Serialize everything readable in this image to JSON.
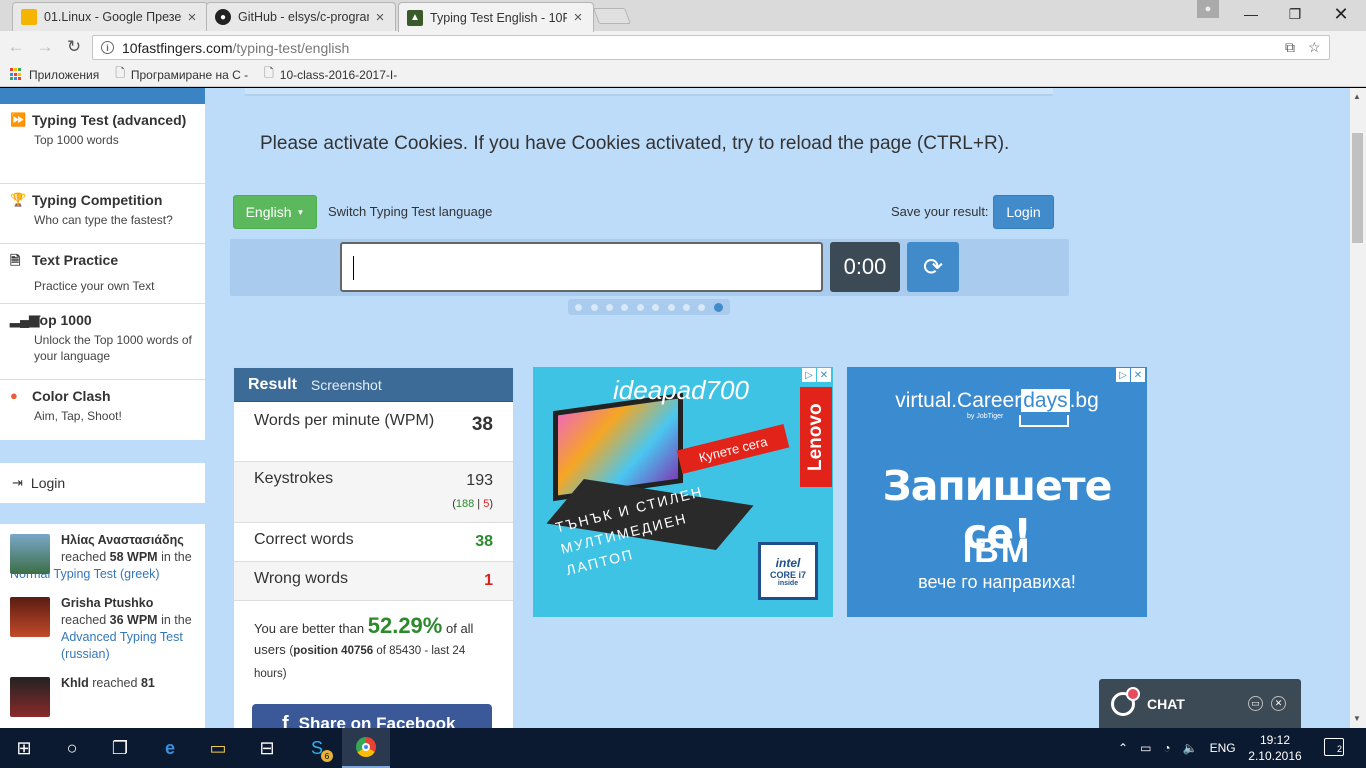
{
  "browser": {
    "tabs": [
      {
        "title": "01.Linux - Google Презе",
        "active": false
      },
      {
        "title": "GitHub - elsys/c-program",
        "active": false
      },
      {
        "title": "Typing Test English - 10F",
        "active": true
      }
    ],
    "url_host": "10fastfingers.com",
    "url_path": "/typing-test/english",
    "bookmarks": [
      {
        "label": "Приложения"
      },
      {
        "label": "Програмиране на С -"
      },
      {
        "label": "10-class-2016-2017-I-"
      }
    ]
  },
  "sidebar": {
    "items": [
      {
        "icon": "fast-forward-icon",
        "title": "Typing Test (advanced)",
        "subtitle": "Top 1000 words"
      },
      {
        "icon": "trophy-icon",
        "title": "Typing Competition",
        "subtitle": "Who can type the fastest?"
      },
      {
        "icon": "document-icon",
        "title": "Text Practice",
        "subtitle": "Practice your own Text"
      },
      {
        "icon": "bars-icon",
        "title": "Top 1000",
        "subtitle": "Unlock the Top 1000 words of your language"
      },
      {
        "icon": "circle-icon",
        "title": "Color Clash",
        "subtitle": "Aim, Tap, Shoot!"
      }
    ],
    "login_label": "Login",
    "activity": [
      {
        "name": "Ηλίας Αναστασιάδης",
        "pre": "reached",
        "wpm": "58 WPM",
        "mid": "in the",
        "link": "Normal Typing Test (greek)"
      },
      {
        "name": "Grisha Ptushko",
        "pre": "reached",
        "wpm": "36 WPM",
        "mid": "in the",
        "link": "Advanced Typing Test (russian)"
      },
      {
        "name": "Khld",
        "pre": "reached",
        "wpm": "81",
        "mid": "",
        "link": ""
      }
    ]
  },
  "main": {
    "cookie_message": "Please activate Cookies. If you have Cookies activated, try to reload the page (CTRL+R).",
    "language_button": "English",
    "switch_label": "Switch Typing Test language",
    "save_label": "Save your result:",
    "login_button": "Login",
    "timer": "0:00",
    "input_value": ""
  },
  "result": {
    "title": "Result",
    "screenshot_tab": "Screenshot",
    "wpm_label": "Words per minute (WPM)",
    "wpm_value": "38",
    "keystrokes_label": "Keystrokes",
    "keystrokes_value": "193",
    "keystrokes_correct": "188",
    "keystrokes_sep": "|",
    "keystrokes_wrong": "5",
    "correct_label": "Correct words",
    "correct_value": "38",
    "wrong_label": "Wrong words",
    "wrong_value": "1",
    "better_pre": "You are better than",
    "better_pct": "52.29%",
    "better_post": "of all users",
    "position_label": "position 40756",
    "position_rest": "of 85430 - last 24 hours)",
    "facebook_button": "Share on Facebook"
  },
  "ads": {
    "ad1": {
      "brand": "ideapad700",
      "lenovo": "Lenovo",
      "buy": "Купете сега",
      "slogan": "ТЪНЪК И СТИЛЕН МУЛТИМЕДИЕН ЛАПТОП",
      "intel_line1": "intel",
      "intel_line2": "CORE i7",
      "intel_line3": "inside"
    },
    "ad2": {
      "site_pre": "virtual.Career",
      "site_hl": "days",
      "site_post": ".bg",
      "by": "by JobTiger",
      "headline": "Запишете се!",
      "ibm": "IBM",
      "tagline": "вече го направихa!"
    }
  },
  "chat": {
    "label": "CHAT"
  },
  "taskbar": {
    "language": "ENG",
    "time": "19:12",
    "date": "2.10.2016 г.",
    "notifications": "2",
    "skype_badge": "6"
  },
  "colors": {
    "page_bg": "#bddcfa",
    "accent_blue": "#428bca",
    "success_green": "#5cb85c",
    "timer_bg": "#3c4a55"
  }
}
